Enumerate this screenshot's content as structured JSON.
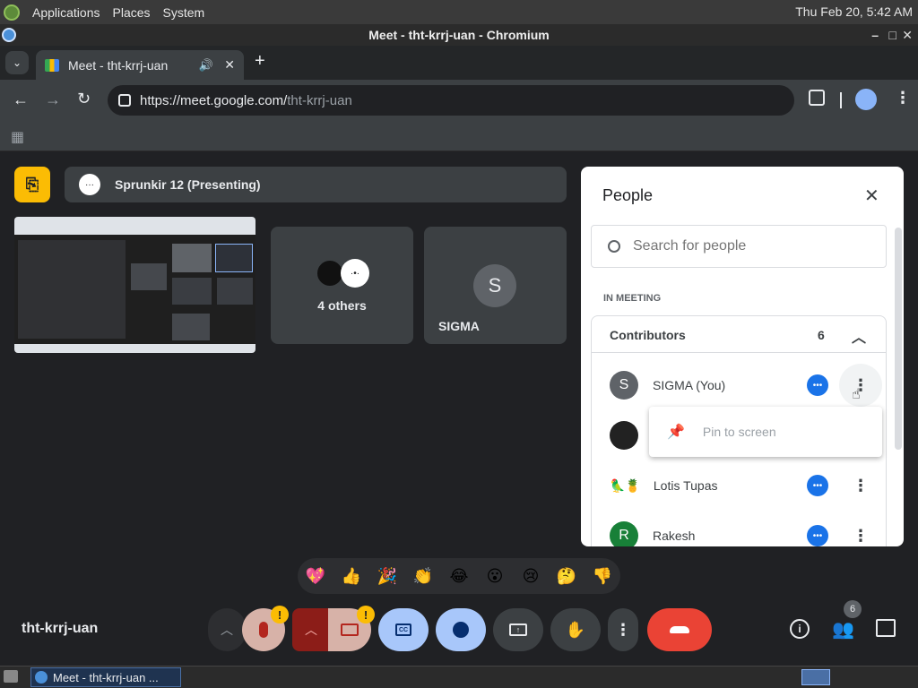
{
  "os": {
    "menu": [
      "Applications",
      "Places",
      "System"
    ],
    "clock": "Thu Feb 20,  5:42 AM"
  },
  "window": {
    "title": "Meet - tht-krrj-uan - Chromium"
  },
  "browser": {
    "tab_title": "Meet - tht-krrj-uan",
    "url_host": "https://meet.google.com/",
    "url_path": "tht-krrj-uan"
  },
  "meet": {
    "presenting_label": "Sprunkir 12 (Presenting)",
    "others_label": "4 others",
    "sigma_tile_initial": "S",
    "sigma_tile_name": "SIGMA",
    "meeting_code": "tht-krrj-uan",
    "participant_count": "6",
    "accent_yellow": "#fbbc04",
    "end_call_red": "#ea4335"
  },
  "people_panel": {
    "title": "People",
    "search_placeholder": "Search for people",
    "section_label": "IN MEETING",
    "group_name": "Contributors",
    "group_count": "6",
    "participants": [
      {
        "name": "SIGMA (You)",
        "initial": "S",
        "color": "#5f6368"
      },
      {
        "name": "",
        "initial": "",
        "color": "#222222"
      },
      {
        "name": "Lotis Tupas",
        "initial": "",
        "color": "#ffffff"
      },
      {
        "name": "Rakesh",
        "initial": "R",
        "color": "#188038"
      }
    ],
    "context_menu": {
      "pin_label": "Pin to screen"
    }
  },
  "reactions": [
    "💖",
    "👍",
    "🎉",
    "👏",
    "😂",
    "😮",
    "😢",
    "🤔",
    "👎"
  ],
  "taskbar": {
    "task_label": "Meet - tht-krrj-uan ..."
  }
}
